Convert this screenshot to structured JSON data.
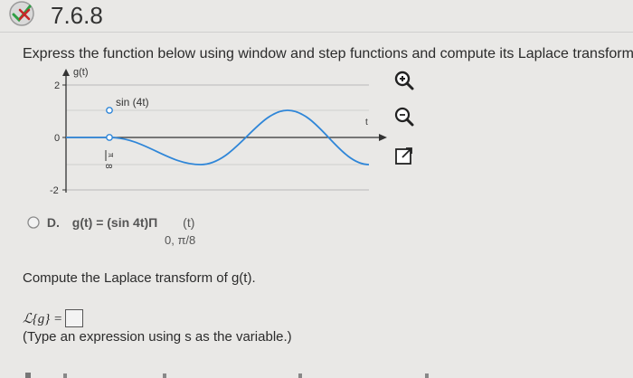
{
  "header": {
    "problem_number": "7.6.8"
  },
  "prompt": "Express the function below using window and step functions and compute its Laplace transform",
  "graph": {
    "y_axis_label": "g(t)",
    "x_axis_label": "t",
    "y_ticks": [
      "2",
      "0",
      "-2"
    ],
    "x_tick_label": "π/8",
    "x_tick_num": "π",
    "x_tick_den": "8",
    "curve_label": "sin (4t)"
  },
  "option": {
    "letter": "D.",
    "expr": "g(t) = (sin 4t)Π",
    "sub": "0, π/8",
    "arg": "(t)"
  },
  "question": "Compute the Laplace transform of g(t).",
  "answer": {
    "lhs": "ℒ{g} =",
    "value": ""
  },
  "hint": "(Type an expression using s as the variable.)",
  "icons": [
    "incorrect-badge-icon",
    "zoom-in-icon",
    "zoom-out-icon",
    "open-window-icon"
  ]
}
